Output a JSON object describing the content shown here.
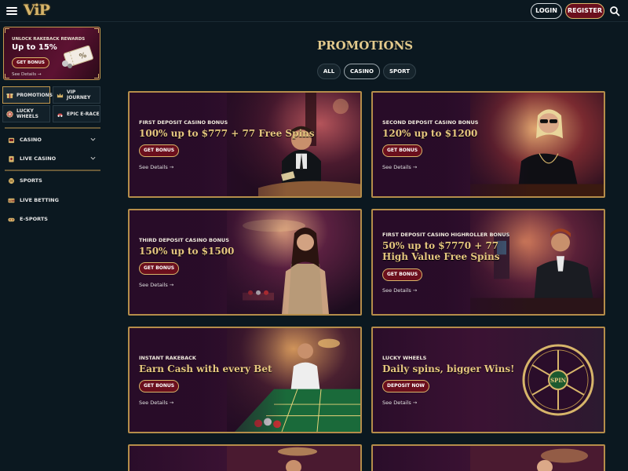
{
  "header": {
    "logo": "ViP",
    "login": "LOGIN",
    "register": "REGISTER"
  },
  "sidebar": {
    "rakeback_banner": {
      "title": "UNLOCK RAKEBACK REWARDS",
      "value": "Up to 15%",
      "button": "GET BONUS",
      "details": "See Details →"
    },
    "tiles": [
      {
        "label": "PROMOTIONS",
        "icon": "gift-icon"
      },
      {
        "label": "VIP JOURNEY",
        "icon": "crown-icon"
      },
      {
        "label": "LUCKY WHEELS",
        "icon": "wheel-icon"
      },
      {
        "label": "EPIC E-RACE",
        "icon": "race-icon"
      }
    ],
    "nav": [
      {
        "label": "CASINO",
        "icon": "slot-icon"
      },
      {
        "label": "LIVE CASINO",
        "icon": "live-casino-icon"
      },
      {
        "label": "SPORTS",
        "icon": "ball-icon"
      },
      {
        "label": "LIVE BETTING",
        "icon": "live-betting-icon"
      },
      {
        "label": "E-SPORTS",
        "icon": "gamepad-icon"
      }
    ]
  },
  "main": {
    "title": "PROMOTIONS",
    "filters": [
      "ALL",
      "CASINO",
      "SPORT"
    ],
    "active_filter": "CASINO",
    "cards": [
      {
        "subtitle": "FIRST DEPOSIT CASINO BONUS",
        "headline": [
          "100% up to $777 + 77 Free Spins"
        ],
        "button": "GET BONUS",
        "details": "See Details →"
      },
      {
        "subtitle": "SECOND DEPOSIT CASINO BONUS",
        "headline": [
          "120% up to $1200"
        ],
        "button": "GET BONUS",
        "details": "See Details →"
      },
      {
        "subtitle": "THIRD DEPOSIT CASINO BONUS",
        "headline": [
          "150% up to $1500"
        ],
        "button": "GET BONUS",
        "details": "See Details →"
      },
      {
        "subtitle": "FIRST DEPOSIT CASINO HIGHROLLER BONUS",
        "headline": [
          "50% up to $7770 + 77",
          "High Value Free Spins"
        ],
        "button": "GET BONUS",
        "details": "See Details →"
      },
      {
        "subtitle": "INSTANT RAKEBACK",
        "headline": [
          "Earn Cash with every Bet"
        ],
        "button": "GET BONUS",
        "details": "See Details →"
      },
      {
        "subtitle": "LUCKY WHEELS",
        "headline": [
          "Daily spins, bigger Wins!"
        ],
        "button": "DEPOSIT NOW",
        "details": "See Details →",
        "wheel_label": "SPIN"
      }
    ]
  },
  "colors": {
    "background": "#0b1820",
    "gold": "#d7b56a",
    "button_red": "#6b0f1d",
    "card_purple": "#3b1233"
  }
}
